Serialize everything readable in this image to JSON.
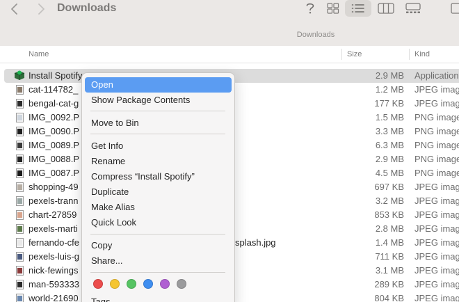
{
  "window": {
    "title": "Downloads",
    "path_title": "Downloads"
  },
  "toolbar": {
    "back_icon": "chevron-left-icon",
    "forward_icon": "chevron-right-icon",
    "help_icon": "question-mark-icon",
    "view_icons": [
      "grid-view-icon",
      "list-view-icon",
      "column-view-icon",
      "gallery-view-icon"
    ],
    "active_view": "list-view-icon"
  },
  "columns": {
    "name": "Name",
    "size": "Size",
    "kind": "Kind"
  },
  "files": [
    {
      "name": "Install Spotify",
      "size": "2.9 MB",
      "kind": "Application",
      "icon": "spotify-installer-icon",
      "selected": true
    },
    {
      "name": "cat-114782_",
      "size": "1.2 MB",
      "kind": "JPEG image",
      "icon": "jpeg-file-icon"
    },
    {
      "name": "bengal-cat-g",
      "size": "177 KB",
      "kind": "JPEG image",
      "icon": "jpeg-file-icon"
    },
    {
      "name": "IMG_0092.P",
      "size": "1.5 MB",
      "kind": "PNG image",
      "icon": "png-file-icon"
    },
    {
      "name": "IMG_0090.P",
      "size": "3.3 MB",
      "kind": "PNG image",
      "icon": "png-file-icon"
    },
    {
      "name": "IMG_0089.P",
      "size": "6.3 MB",
      "kind": "PNG image",
      "icon": "png-file-icon"
    },
    {
      "name": "IMG_0088.P",
      "size": "2.9 MB",
      "kind": "PNG image",
      "icon": "png-file-icon"
    },
    {
      "name": "IMG_0087.P",
      "size": "4.5 MB",
      "kind": "PNG image",
      "icon": "png-file-icon"
    },
    {
      "name": "shopping-49",
      "size": "697 KB",
      "kind": "JPEG image",
      "icon": "jpeg-file-icon"
    },
    {
      "name": "pexels-trann",
      "size": "3.2 MB",
      "kind": "JPEG image",
      "icon": "jpeg-file-icon"
    },
    {
      "name": "chart-27859",
      "size": "853 KB",
      "kind": "JPEG image",
      "icon": "jpeg-file-icon"
    },
    {
      "name": "pexels-marti",
      "size": "2.8 MB",
      "kind": "JPEG image",
      "icon": "jpeg-file-icon"
    },
    {
      "name": "fernando-cfe",
      "name_tail": "splash.jpg",
      "size": "1.4 MB",
      "kind": "JPEG image",
      "icon": "jpeg-file-icon"
    },
    {
      "name": "pexels-luis-g",
      "size": "711 KB",
      "kind": "JPEG image",
      "icon": "jpeg-file-icon"
    },
    {
      "name": "nick-fewings",
      "size": "3.1 MB",
      "kind": "JPEG image",
      "icon": "jpeg-file-icon"
    },
    {
      "name": "man-593333",
      "size": "289 KB",
      "kind": "JPEG image",
      "icon": "jpeg-file-icon"
    },
    {
      "name": "world-21690",
      "size": "804 KB",
      "kind": "JPEG image",
      "icon": "jpeg-file-icon"
    }
  ],
  "context_menu": {
    "open": "Open",
    "show_package_contents": "Show Package Contents",
    "move_to_bin": "Move to Bin",
    "get_info": "Get Info",
    "rename": "Rename",
    "compress": "Compress “Install Spotify”",
    "duplicate": "Duplicate",
    "make_alias": "Make Alias",
    "quick_look": "Quick Look",
    "copy": "Copy",
    "share": "Share...",
    "tags": "Tags...",
    "tag_colors": [
      {
        "name": "red-tag",
        "color": "#ec4d4c"
      },
      {
        "name": "yellow-tag",
        "color": "#f5c531"
      },
      {
        "name": "green-tag",
        "color": "#56c463"
      },
      {
        "name": "blue-tag",
        "color": "#3f8ef0"
      },
      {
        "name": "purple-tag",
        "color": "#b05fd2"
      },
      {
        "name": "gray-tag",
        "color": "#9b9b9d"
      }
    ]
  },
  "colors": {
    "highlight": "#5b9cf2",
    "toolbar_bg": "#ebe8e6",
    "selected_row": "#dcdcdc"
  }
}
